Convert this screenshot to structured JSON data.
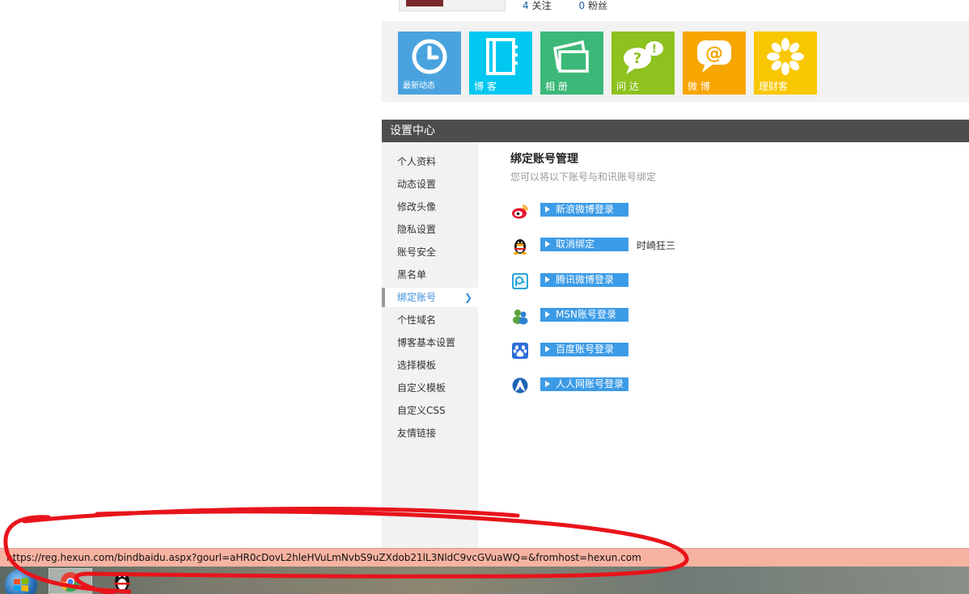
{
  "profile": {
    "follow_count": "4",
    "follow_label": "关注",
    "fans_count": "0",
    "fans_label": "粉丝"
  },
  "tiles": [
    {
      "label": "最新动态",
      "icon": "clock-icon",
      "color": "#4aa3df"
    },
    {
      "label": "博 客",
      "icon": "notebook-icon",
      "color": "#00c8f0"
    },
    {
      "label": "相 册",
      "icon": "photo-album-icon",
      "color": "#3cb878"
    },
    {
      "label": "问 达",
      "icon": "question-bubble-icon",
      "color": "#8dc21f"
    },
    {
      "label": "微 博",
      "icon": "at-bubble-icon",
      "color": "#f7a600"
    },
    {
      "label": "理财客",
      "icon": "flower-icon",
      "color": "#f9c700"
    }
  ],
  "settings": {
    "header": "设置中心",
    "menu": [
      {
        "label": "个人资料"
      },
      {
        "label": "动态设置"
      },
      {
        "label": "修改头像"
      },
      {
        "label": "隐私设置"
      },
      {
        "label": "账号安全"
      },
      {
        "label": "黑名单"
      },
      {
        "label": "绑定账号",
        "active": true
      },
      {
        "label": "个性域名"
      },
      {
        "label": "博客基本设置"
      },
      {
        "label": "选择模板"
      },
      {
        "label": "自定义模板"
      },
      {
        "label": "自定义CSS"
      },
      {
        "label": "友情链接"
      }
    ]
  },
  "content": {
    "title": "绑定账号管理",
    "subtitle": "您可以将以下账号与和讯账号绑定",
    "accounts": [
      {
        "icon": "sina-weibo-icon",
        "button": "新浪微博登录",
        "user": ""
      },
      {
        "icon": "qq-penguin-icon",
        "button": "取消绑定",
        "user": "时崎狂三"
      },
      {
        "icon": "tencent-weibo-icon",
        "button": "腾讯微博登录",
        "user": ""
      },
      {
        "icon": "msn-icon",
        "button": "MSN账号登录",
        "user": ""
      },
      {
        "icon": "baidu-paw-icon",
        "button": "百度账号登录",
        "user": ""
      },
      {
        "icon": "renren-icon",
        "button": "人人网账号登录",
        "user": ""
      }
    ]
  },
  "status_bar": {
    "url": "https://reg.hexun.com/bindbaidu.aspx?gourl=aHR0cDovL2hleHVuLmNvbS9uZXdob21lL3NldC9vcGVuaWQ=&fromhost=hexun.com"
  },
  "taskbar": {
    "items": [
      {
        "icon": "windows-start-icon"
      },
      {
        "icon": "chrome-browser-icon"
      },
      {
        "icon": "qq-penguin-icon"
      }
    ]
  },
  "colors": {
    "accent_blue": "#3c9be6",
    "header_gray": "#4d4d4d",
    "sidebar_bg": "#f2f2f2",
    "annotation_red": "#e8141b",
    "status_bg": "#f7b3a2"
  }
}
